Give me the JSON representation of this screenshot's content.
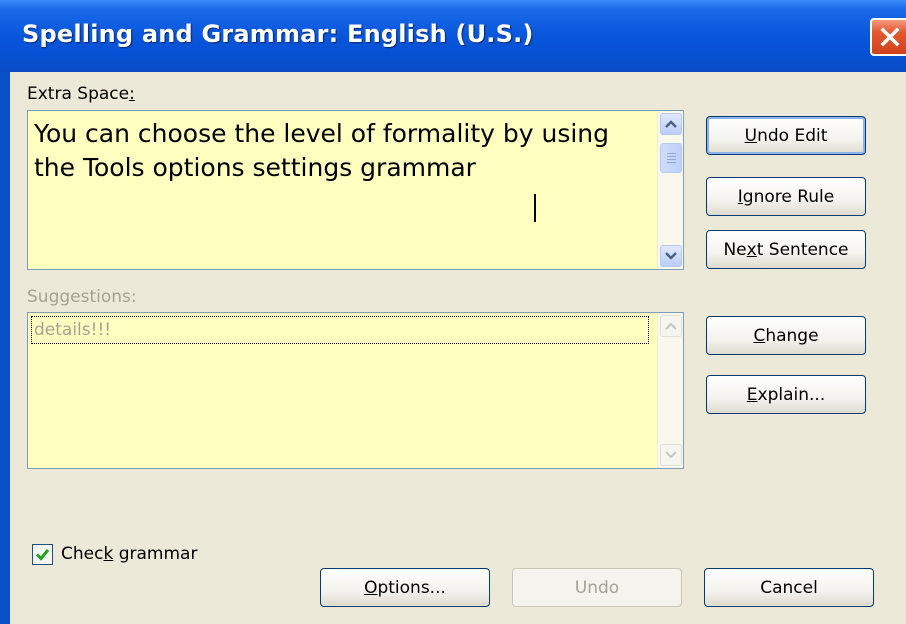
{
  "window": {
    "title": "Spelling and Grammar: English (U.S.)"
  },
  "problem": {
    "label_pre": "Extra Space",
    "label_post": ":",
    "text": "You can choose the level of formality by using the Tools options settings grammar "
  },
  "suggestions": {
    "label": "Suggestions:",
    "items": [
      "details!!!"
    ]
  },
  "side_buttons": {
    "undo_edit": {
      "pre": "",
      "key": "U",
      "post": "ndo Edit"
    },
    "ignore_rule": {
      "pre": "",
      "key": "I",
      "post": "gnore Rule"
    },
    "next_sentence": {
      "pre": "Ne",
      "key": "x",
      "post": "t Sentence"
    },
    "change": {
      "pre": "",
      "key": "C",
      "post": "hange"
    },
    "explain": {
      "pre": "",
      "key": "E",
      "post": "xplain..."
    }
  },
  "check_grammar": {
    "pre": "Chec",
    "key": "k",
    "post": " grammar",
    "checked": true
  },
  "bottom_buttons": {
    "options": {
      "pre": "",
      "key": "O",
      "post": "ptions..."
    },
    "undo": "Undo",
    "cancel": "Cancel"
  },
  "colors": {
    "titlebar": "#0a58dc",
    "dialog_bg": "#ece9d8",
    "textbox_bg": "#ffffc0",
    "close_button": "#d2421c",
    "checkmark": "#21a121",
    "disabled_text": "#a5a294"
  },
  "icons": {
    "close": "close-icon",
    "scroll_up": "scroll-up-arrow-icon",
    "scroll_down": "scroll-down-arrow-icon",
    "checkmark": "checkmark-icon"
  }
}
